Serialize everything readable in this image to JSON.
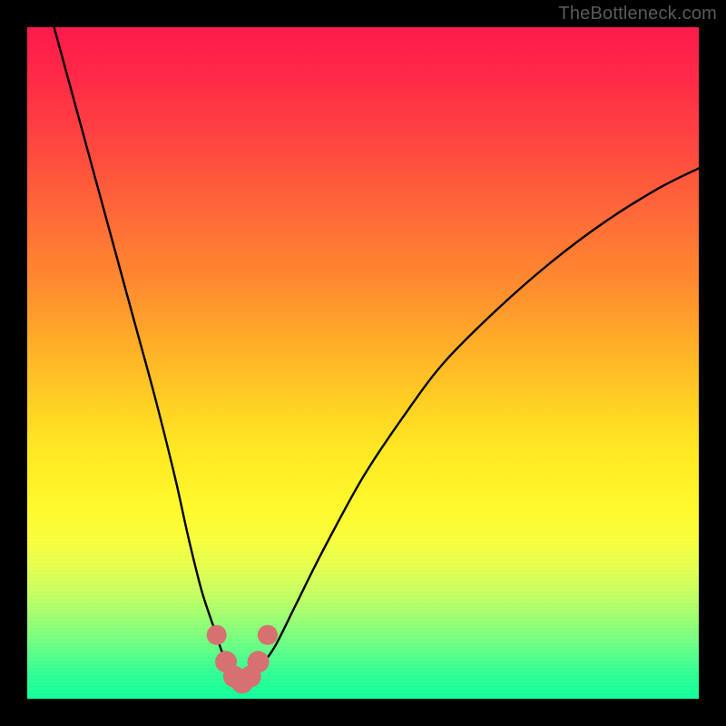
{
  "watermark": "TheBottleneck.com",
  "chart_data": {
    "type": "line",
    "title": "",
    "xlabel": "",
    "ylabel": "",
    "xlim": [
      0,
      100
    ],
    "ylim": [
      0,
      100
    ],
    "series": [
      {
        "name": "bottleneck-curve",
        "x": [
          4,
          7,
          10,
          13,
          16,
          19,
          22,
          24,
          26,
          28,
          29,
          30,
          31,
          32,
          33,
          34,
          35,
          37,
          40,
          44,
          50,
          56,
          62,
          70,
          78,
          86,
          94,
          100
        ],
        "y": [
          100,
          89,
          78,
          67,
          56,
          45,
          33,
          24,
          16,
          10,
          7,
          5,
          3,
          2.4,
          2.4,
          3,
          5,
          8,
          14,
          22,
          33,
          42,
          50,
          58,
          65,
          71,
          76,
          79
        ]
      }
    ],
    "markers": {
      "name": "highlight-dots",
      "color": "#d77070",
      "x": [
        28.2,
        29.6,
        30.8,
        32.0,
        33.2,
        34.4,
        35.8
      ],
      "y": [
        9.5,
        5.5,
        3.3,
        2.4,
        3.3,
        5.5,
        9.5
      ]
    },
    "gradient_stops": [
      {
        "pos": 0.0,
        "color": "#ff1a4d"
      },
      {
        "pos": 0.18,
        "color": "#ff4840"
      },
      {
        "pos": 0.38,
        "color": "#ff8a2f"
      },
      {
        "pos": 0.56,
        "color": "#ffd023"
      },
      {
        "pos": 0.7,
        "color": "#fff629"
      },
      {
        "pos": 0.84,
        "color": "#c9ff60"
      },
      {
        "pos": 1.0,
        "color": "#10ff9b"
      }
    ]
  }
}
